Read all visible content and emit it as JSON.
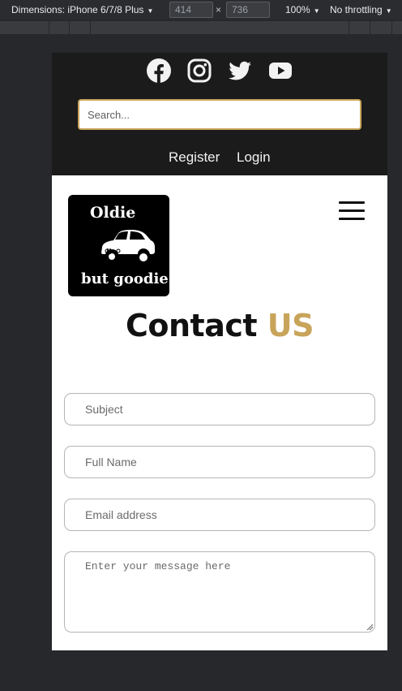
{
  "devtools": {
    "dimensions_label": "Dimensions: iPhone 6/7/8 Plus",
    "width_value": "414",
    "height_value": "736",
    "times_symbol": "×",
    "zoom_label": "100%",
    "throttle_label": "No throttling"
  },
  "topbar": {
    "social_icons": [
      "facebook-icon",
      "instagram-icon",
      "twitter-icon",
      "youtube-icon"
    ],
    "search_placeholder": "Search...",
    "register_label": "Register",
    "login_label": "Login"
  },
  "header": {
    "logo_line1": "Oldie",
    "logo_line2": "but goodie"
  },
  "contact": {
    "title_main": "Contact",
    "title_accent": "US",
    "subject_placeholder": "Subject",
    "fullname_placeholder": "Full Name",
    "email_placeholder": "Email address",
    "message_placeholder": "Enter your message here"
  },
  "colors": {
    "accent": "#c8a45a",
    "topbar_bg": "#1b1b1b",
    "page_bg": "#27282c"
  }
}
